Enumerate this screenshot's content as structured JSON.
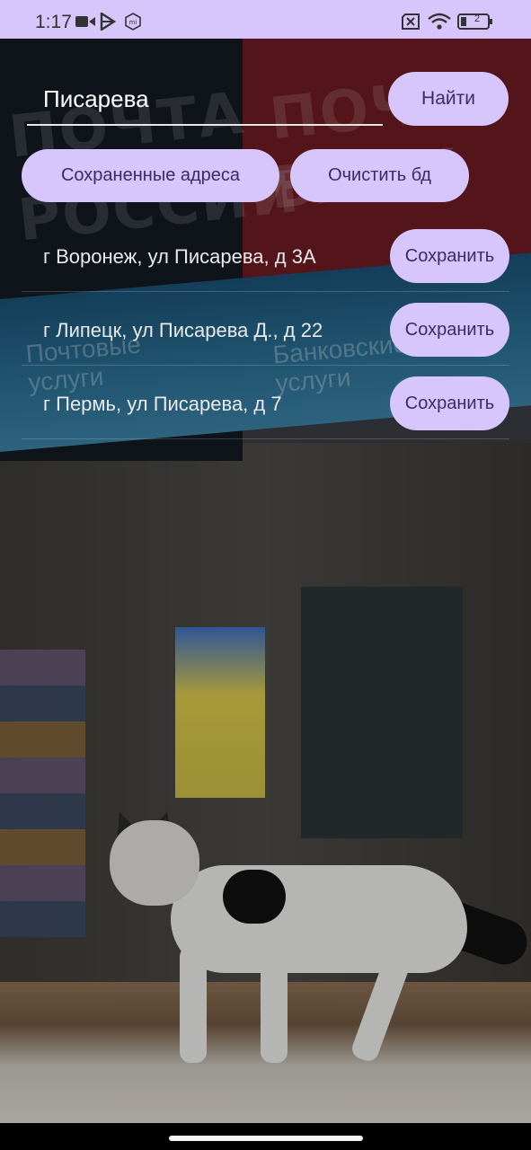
{
  "status_bar": {
    "time": "1:17",
    "battery_level": "2",
    "icons": [
      "video-camera-icon",
      "play-store-icon",
      "mi-icon",
      "no-sim-icon",
      "wifi-icon",
      "battery-icon"
    ]
  },
  "search": {
    "value": "Писарева",
    "button_label": "Найти"
  },
  "actions": {
    "saved_addresses_label": "Сохраненные адреса",
    "clear_db_label": "Очистить бд"
  },
  "results": [
    {
      "address": "г Воронеж, ул Писарева, д 3А",
      "save_label": "Сохранить"
    },
    {
      "address": "г Липецк, ул Писарева Д., д 22",
      "save_label": "Сохранить"
    },
    {
      "address": "г Пермь, ул Писарева, д 7",
      "save_label": "Сохранить"
    }
  ],
  "colors": {
    "accent": "#d6c6fb",
    "accent_text": "#3b2a6b"
  }
}
